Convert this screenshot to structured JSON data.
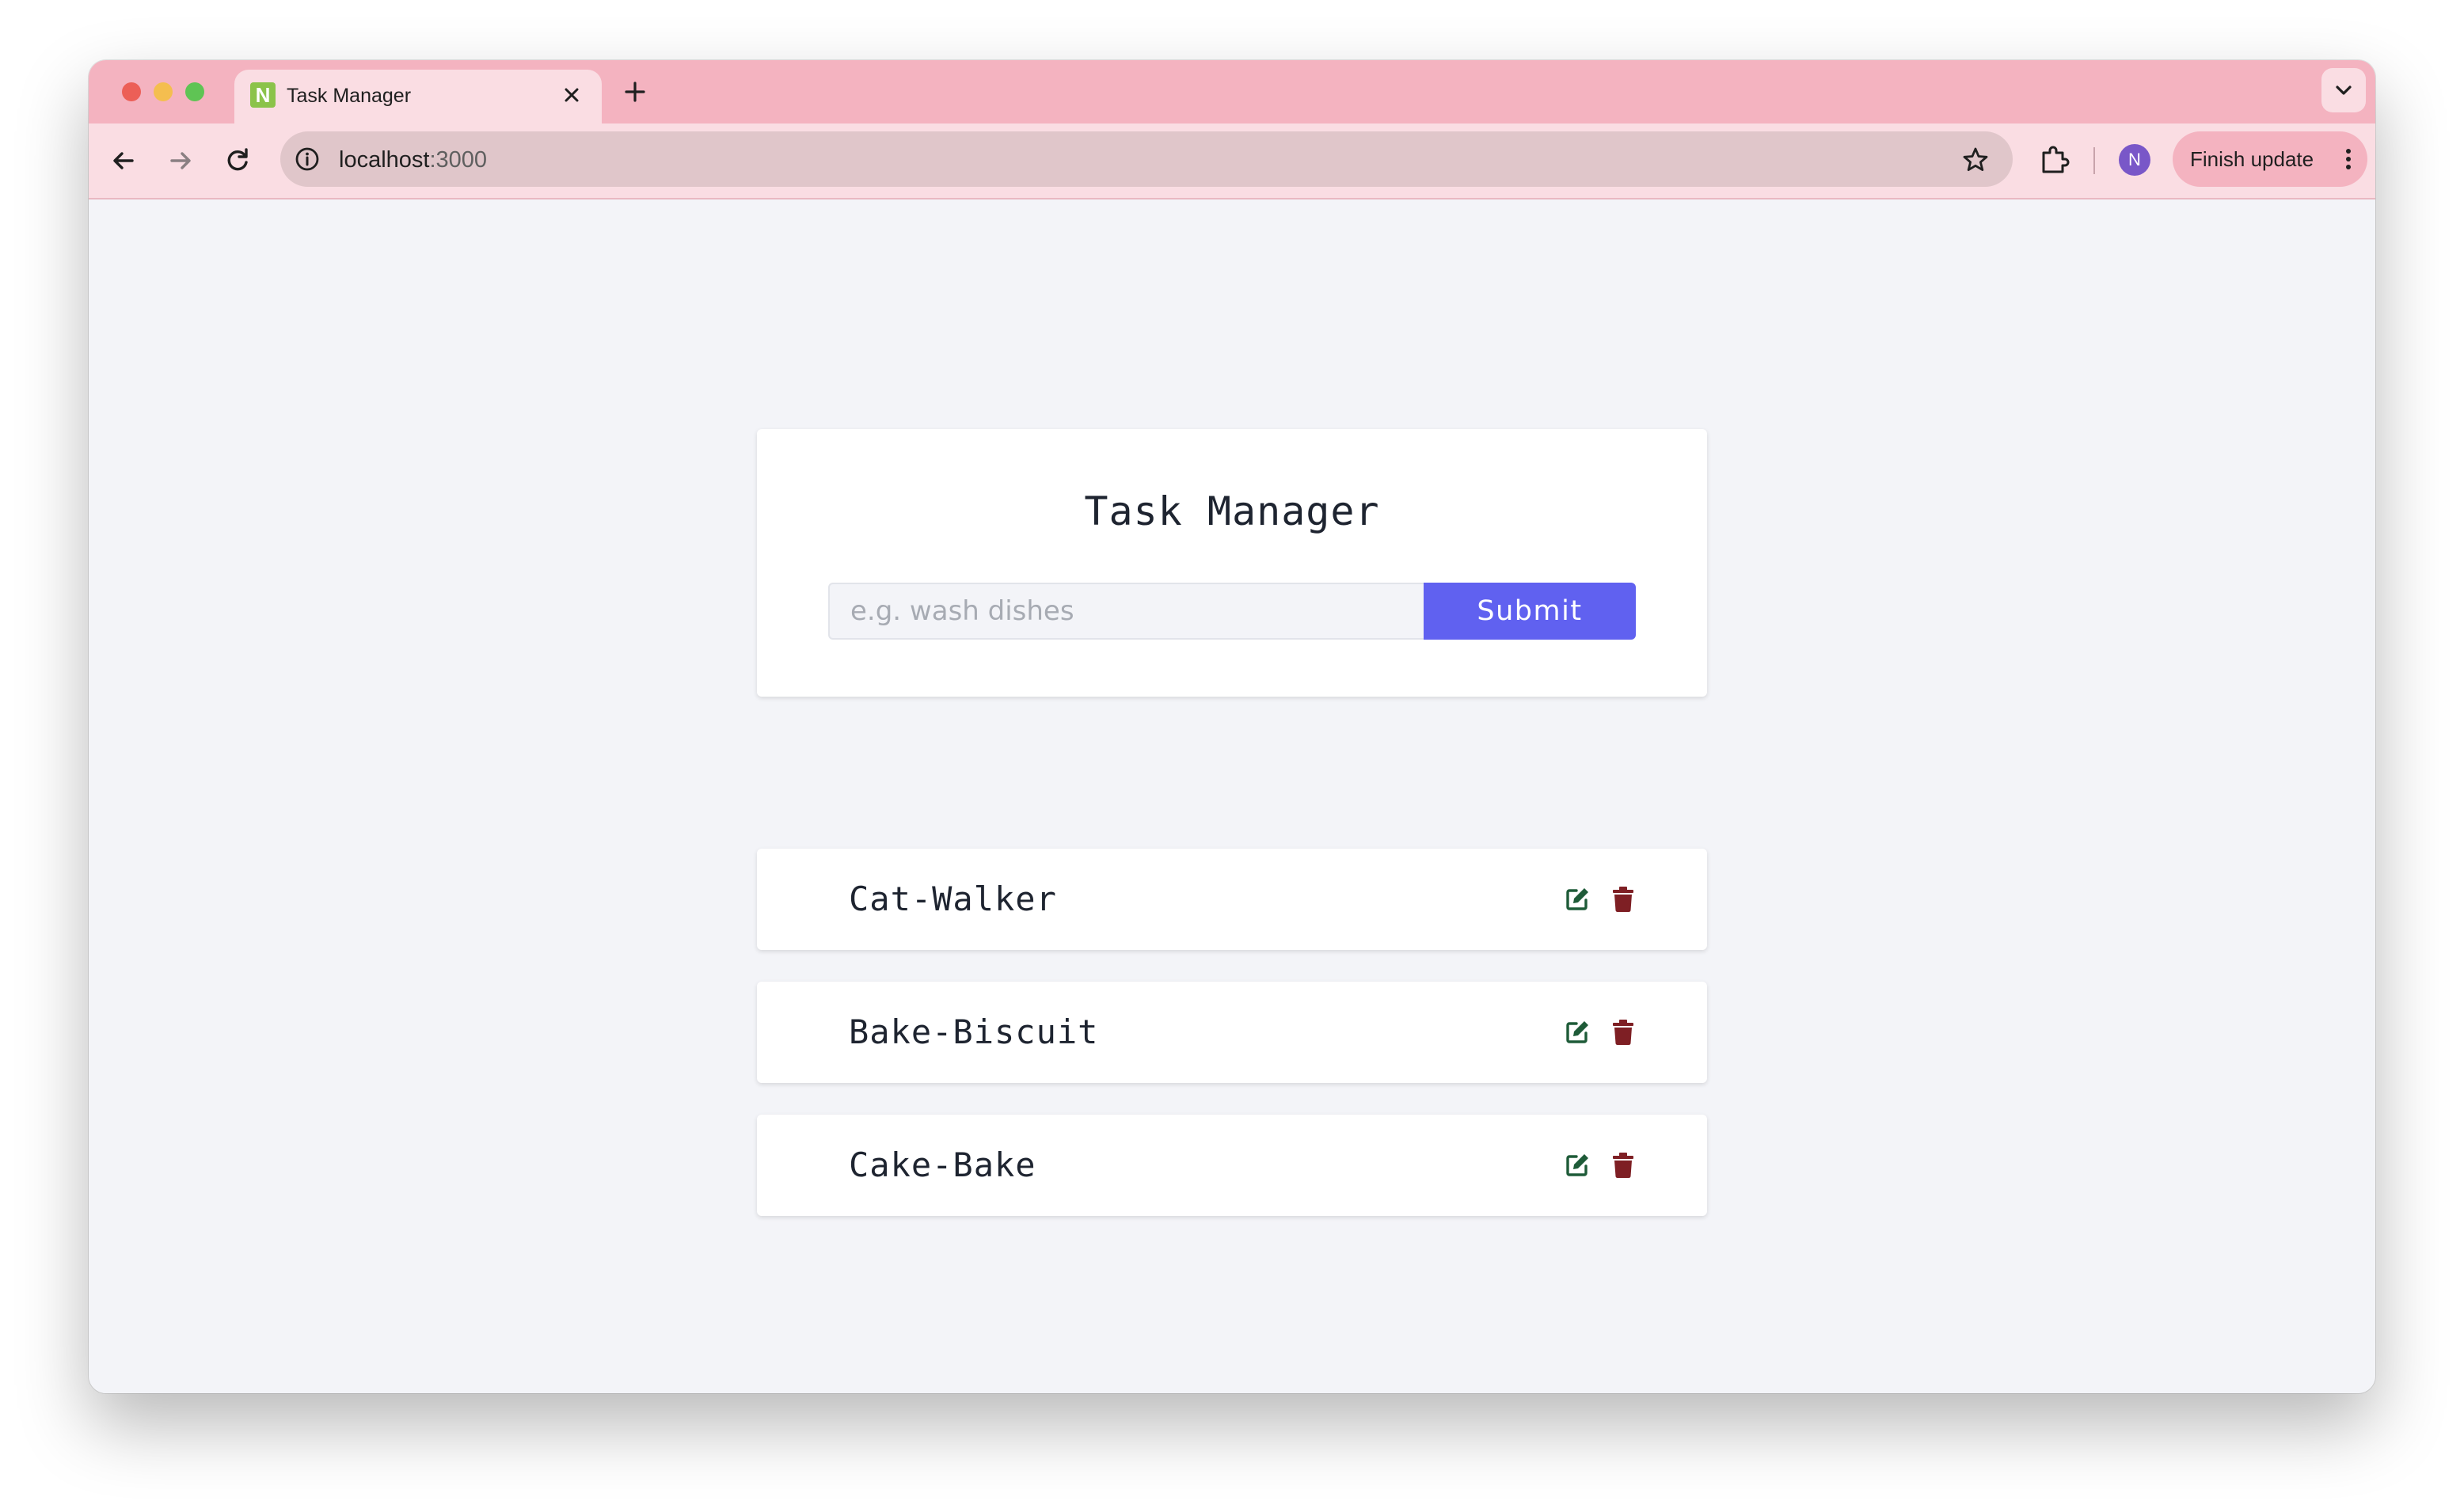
{
  "browser": {
    "tab_title": "Task Manager",
    "favicon_letter": "N",
    "url_host": "localhost",
    "url_port": ":3000",
    "avatar_letter": "N",
    "update_button_label": "Finish update"
  },
  "app": {
    "title": "Task Manager",
    "input_placeholder": "e.g. wash dishes",
    "input_value": "",
    "submit_label": "Submit",
    "tasks": [
      {
        "name": "Cat-Walker"
      },
      {
        "name": "Bake-Biscuit"
      },
      {
        "name": "Cake-Bake"
      }
    ]
  },
  "colors": {
    "tabbar": "#f4b3c0",
    "toolbar": "#fadde3",
    "page_background": "#f3f4f8",
    "submit_button": "#6061f0",
    "edit_icon": "#1e5b38",
    "delete_icon": "#7e1f24"
  },
  "icons": {
    "edit": "edit-icon",
    "delete": "trash-icon"
  }
}
